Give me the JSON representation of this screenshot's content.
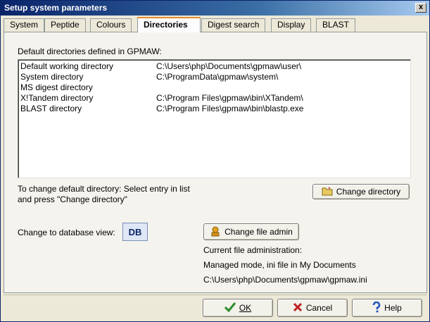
{
  "window": {
    "title": "Setup system parameters",
    "close_glyph": "x"
  },
  "tabs": [
    {
      "label": "System",
      "active": false
    },
    {
      "label": "Peptide",
      "active": false
    },
    {
      "label": "Colours",
      "active": false
    },
    {
      "label": "Directories",
      "active": true
    },
    {
      "label": "Digest search",
      "active": false
    },
    {
      "label": "Display",
      "active": false
    },
    {
      "label": "BLAST",
      "active": false
    }
  ],
  "directories": {
    "heading": "Default directories defined in GPMAW:",
    "rows": [
      {
        "name": "Default working directory",
        "path": "C:\\Users\\php\\Documents\\gpmaw\\user\\"
      },
      {
        "name": "System directory",
        "path": "C:\\ProgramData\\gpmaw\\system\\"
      },
      {
        "name": "MS digest directory",
        "path": ""
      },
      {
        "name": "X!Tandem directory",
        "path": "C:\\Program Files\\gpmaw\\bin\\XTandem\\"
      },
      {
        "name": "BLAST directory",
        "path": "C:\\Program Files\\gpmaw\\bin\\blastp.exe"
      }
    ],
    "hint_line1": "To change default directory: Select entry in list",
    "hint_line2": "and press \"Change directory\"",
    "change_button": "Change directory"
  },
  "database": {
    "label": "Change to database view:",
    "db_button": "DB",
    "change_admin_button": "Change file admin",
    "current_title": "Current file administration:",
    "mode": "Managed mode, ini file in My Documents",
    "ini_path": "C:\\Users\\php\\Documents\\gpmaw\\gpmaw.ini"
  },
  "footer": {
    "ok": "OK",
    "cancel": "Cancel",
    "help": "Help"
  },
  "icons": {
    "ok": "check-icon",
    "cancel": "cross-icon",
    "help": "question-icon",
    "change_directory": "folder-icon",
    "change_admin": "admin-icon"
  },
  "colors": {
    "ok_icon": "#2a8a2a",
    "cancel_icon": "#c02020",
    "help_icon": "#2050c0",
    "active_tab_accent": "#e68b2c"
  }
}
